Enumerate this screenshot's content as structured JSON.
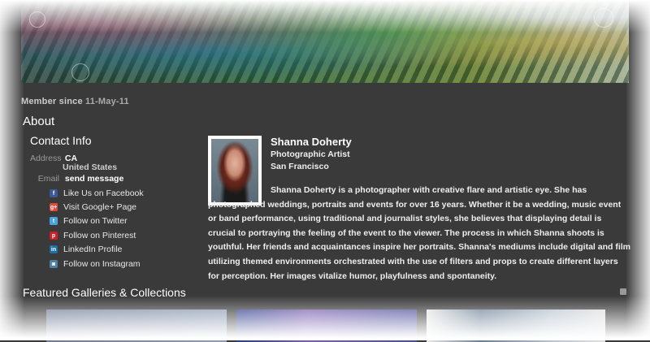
{
  "profile": {
    "member_since_label": "Member since",
    "member_since_date": "11-May-11",
    "about_heading": "About",
    "contact_heading": "Contact Info",
    "address_label": "Address",
    "address_line1": "CA",
    "address_line2": "United States",
    "email_label": "Email",
    "email_value": "send message",
    "name": "Shanna Doherty",
    "role": "Photographic Artist",
    "city": "San Francisco",
    "bio": "Shanna Doherty is a photographer with creative flare and artistic eye. She has photographed weddings, portraits and events for over 16 years. Whether it be a wedding, music event or band performance, using traditional and journalist styles, she believes that displaying detail is crucial to portraying the feeling of the event to the viewer. The process in which Shanna shoots is youthful. Her friends and acquaintances inspire her portraits. Shanna's mediums include digital and film utilizing themed environments orchestrated with the use of filters and props to create different layers for perception. Her images vitalize humor, playfulness and spontaneity."
  },
  "social": [
    {
      "label": "Like Us on Facebook",
      "icon": "facebook-icon",
      "color": "#3b5998",
      "glyph": "f"
    },
    {
      "label": "Visit Google+ Page",
      "icon": "google-plus-icon",
      "color": "#dd4b39",
      "glyph": "g+"
    },
    {
      "label": "Follow on Twitter",
      "icon": "twitter-icon",
      "color": "#4aa3df",
      "glyph": "t"
    },
    {
      "label": "Follow on Pinterest",
      "icon": "pinterest-icon",
      "color": "#cb2027",
      "glyph": "p"
    },
    {
      "label": "LinkedIn Profile",
      "icon": "linkedin-icon",
      "color": "#1d6fa5",
      "glyph": "in"
    },
    {
      "label": "Follow on Instagram",
      "icon": "instagram-icon",
      "color": "#517fa4",
      "glyph": "◙"
    }
  ],
  "featured": {
    "heading": "Featured Galleries & Collections"
  }
}
